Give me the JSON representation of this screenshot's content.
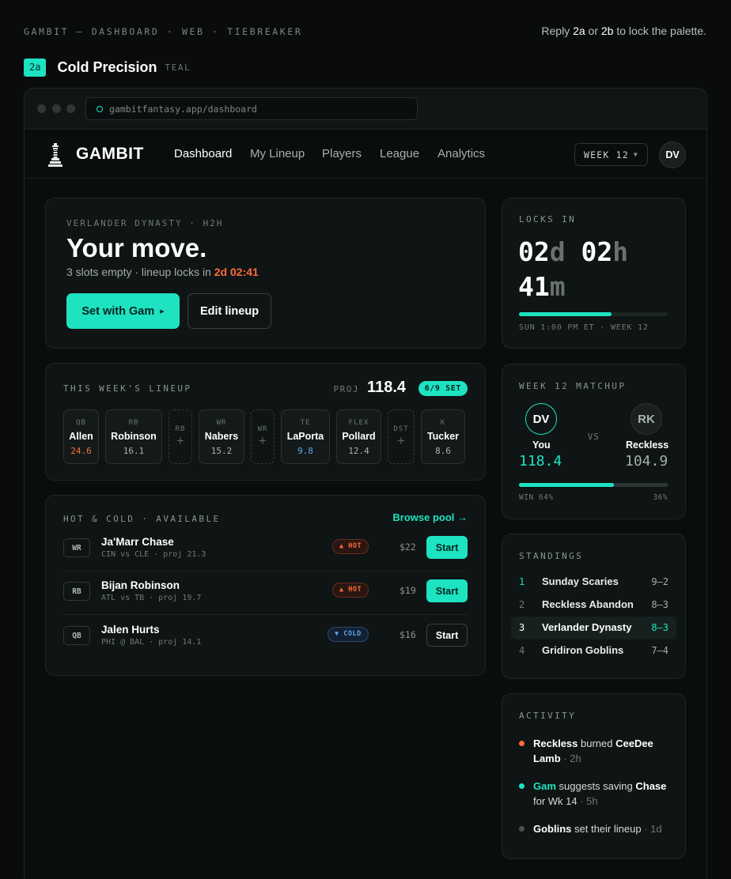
{
  "meta": {
    "breadcrumb": "GAMBIT — DASHBOARD · WEB · TIEBREAKER",
    "reply_prefix": "Reply ",
    "reply_opt_a": "2a",
    "reply_or": " or ",
    "reply_opt_b": "2b",
    "reply_suffix": " to lock the palette.",
    "option_chip": "2a",
    "option_title": "Cold Precision",
    "option_sub": "TEAL"
  },
  "colors": {
    "accent": "#1de3c1",
    "hot": "#ff6b3d",
    "cold": "#5aa6e8",
    "bg": "#090b0c"
  },
  "browser": {
    "url": "gambitfantasy.app/dashboard"
  },
  "nav": {
    "logo": "GAMBIT",
    "logo_icon": "chess-rook-icon",
    "links": [
      "Dashboard",
      "My Lineup",
      "Players",
      "League",
      "Analytics"
    ],
    "active": "Dashboard",
    "week": "WEEK 12",
    "avatar": "DV"
  },
  "hero": {
    "eyebrow": "VERLANDER DYNASTY · H2H",
    "title": "Your move.",
    "sub_prefix": "3 slots empty · lineup locks in ",
    "sub_timer": "2d 02:41",
    "primary_btn": "Set with Gam",
    "secondary_btn": "Edit lineup"
  },
  "locks": {
    "label": "LOCKS IN",
    "d": "02",
    "d_unit": "d",
    "h": "02",
    "h_unit": "h",
    "m": "41",
    "m_unit": "m",
    "progress": 0.62,
    "footer": "SUN 1:00 PM ET · WEEK 12"
  },
  "lineup": {
    "label": "THIS WEEK'S LINEUP",
    "proj_label": "PROJ",
    "proj_value": "118.4",
    "set_badge": "6/9 SET",
    "slots": [
      {
        "pos": "QB",
        "name": "Allen",
        "pts": "24.6",
        "tone": "hot"
      },
      {
        "pos": "RB",
        "name": "Robinson",
        "pts": "16.1",
        "tone": ""
      },
      {
        "pos": "RB",
        "empty": true
      },
      {
        "pos": "WR",
        "name": "Nabers",
        "pts": "15.2",
        "tone": ""
      },
      {
        "pos": "WR",
        "empty": true
      },
      {
        "pos": "TE",
        "name": "LaPorta",
        "pts": "9.8",
        "tone": "cold"
      },
      {
        "pos": "FLEX",
        "name": "Pollard",
        "pts": "12.4",
        "tone": ""
      },
      {
        "pos": "DST",
        "empty": true
      },
      {
        "pos": "K",
        "name": "Tucker",
        "pts": "8.6",
        "tone": ""
      }
    ]
  },
  "matchup": {
    "label": "WEEK 12 MATCHUP",
    "you_avatar": "DV",
    "you_name": "You",
    "you_score": "118.4",
    "vs": "VS",
    "opp_avatar": "RK",
    "opp_name": "Reckless",
    "opp_score": "104.9",
    "win_prob": 0.64,
    "win_label": "WIN 64%",
    "opp_pct": "36%"
  },
  "hotcold": {
    "label": "HOT & COLD · AVAILABLE",
    "browse": "Browse pool →",
    "players": [
      {
        "pos": "WR",
        "name": "Ja'Marr Chase",
        "info": "CIN vs CLE · proj 21.3",
        "trend": "▲ HOT",
        "trend_type": "hot",
        "price": "$22",
        "start": "Start",
        "primary": true
      },
      {
        "pos": "RB",
        "name": "Bijan Robinson",
        "info": "ATL vs TB · proj 19.7",
        "trend": "▲ HOT",
        "trend_type": "hot",
        "price": "$19",
        "start": "Start",
        "primary": true
      },
      {
        "pos": "QB",
        "name": "Jalen Hurts",
        "info": "PHI @ BAL · proj 14.1",
        "trend": "▼ COLD",
        "trend_type": "cold",
        "price": "$16",
        "start": "Start",
        "primary": false
      }
    ]
  },
  "standings": {
    "label": "STANDINGS",
    "rows": [
      {
        "rank": "1",
        "team": "Sunday Scaries",
        "record": "9–2",
        "me": false
      },
      {
        "rank": "2",
        "team": "Reckless Abandon",
        "record": "8–3",
        "me": false
      },
      {
        "rank": "3",
        "team": "Verlander Dynasty",
        "record": "8–3",
        "me": true
      },
      {
        "rank": "4",
        "team": "Gridiron Goblins",
        "record": "7–4",
        "me": false
      }
    ]
  },
  "activity": {
    "label": "ACTIVITY",
    "items": [
      {
        "actor": "Reckless",
        "text": " burned ",
        "object": "CeeDee Lamb",
        "text2": "",
        "time": " · 2h",
        "color": "#ff6b3d",
        "actor_accent": false
      },
      {
        "actor": "Gam",
        "text": " suggests saving ",
        "object": "Chase",
        "text2": " for Wk 14",
        "time": " · 5h",
        "color": "#1de3c1",
        "actor_accent": true
      },
      {
        "actor": "Goblins",
        "text": " set their lineup",
        "object": "",
        "text2": "",
        "time": " · 1d",
        "color": "#4a5351",
        "actor_accent": false
      }
    ]
  }
}
